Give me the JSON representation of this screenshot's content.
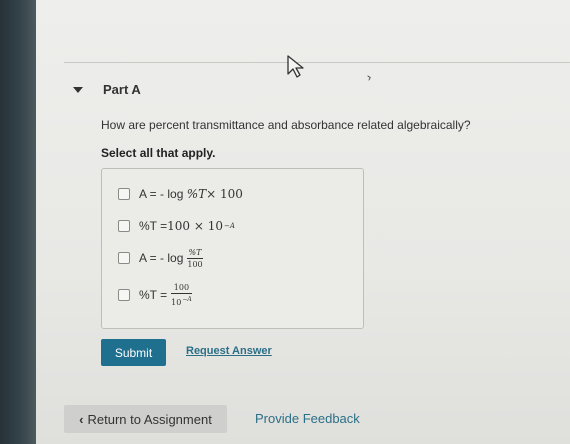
{
  "part": {
    "title": "Part A"
  },
  "question": {
    "prompt": "How are percent transmittance and absorbance related algebraically?",
    "instruction": "Select all that apply."
  },
  "options": [
    {
      "lead": "A = - log",
      "math": "%T",
      "rest": " × 100",
      "checked": false
    },
    {
      "lead": "%T = ",
      "math": "100 × 10",
      "exp": "−A",
      "checked": false
    },
    {
      "lead": "A = - log",
      "num": "%T",
      "den": "100",
      "checked": false
    },
    {
      "lead": "%T = ",
      "num": "100",
      "den": "10",
      "den_exp": "−A",
      "checked": false
    }
  ],
  "actions": {
    "submit_label": "Submit",
    "request_label": "Request Answer"
  },
  "footer": {
    "return_label": "Return to Assignment",
    "feedback_label": "Provide Feedback"
  },
  "colors": {
    "accent": "#1f6f8f",
    "link": "#2b6f86"
  },
  "icons": {
    "cursor": "arrow-pointer-icon",
    "collapse": "caret-down-icon",
    "back": "chevron-left-icon"
  }
}
